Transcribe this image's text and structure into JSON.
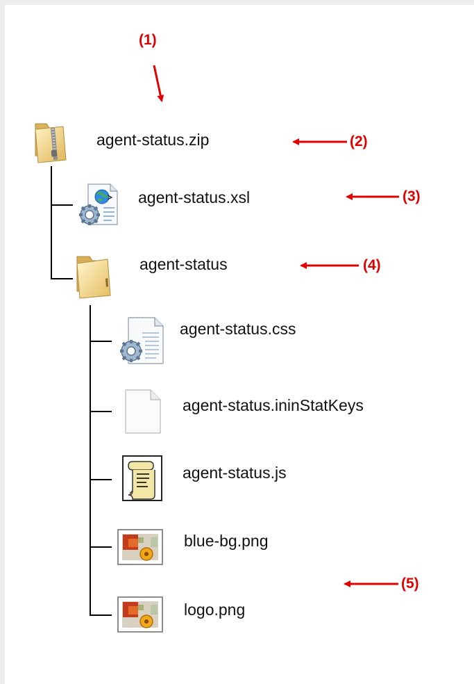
{
  "tree": {
    "root": {
      "label": "agent-status.zip",
      "icon": "zip-folder-icon"
    },
    "children": [
      {
        "label": "agent-status.xsl",
        "icon": "xsl-file-icon"
      },
      {
        "label": "agent-status",
        "icon": "folder-icon"
      }
    ],
    "folder_contents": [
      {
        "label": "agent-status.css",
        "icon": "css-file-icon"
      },
      {
        "label": "agent-status.ininStatKeys",
        "icon": "blank-file-icon"
      },
      {
        "label": "agent-status.js",
        "icon": "script-file-icon"
      },
      {
        "label": "blue-bg.png",
        "icon": "image-file-icon"
      },
      {
        "label": "logo.png",
        "icon": "image-file-icon"
      }
    ]
  },
  "annotations": {
    "m1": "(1)",
    "m2": "(2)",
    "m3": "(3)",
    "m4": "(4)",
    "m5": "(5)"
  },
  "colors": {
    "annotation": "#e00000",
    "tree_line": "#000000",
    "text": "#111111"
  }
}
